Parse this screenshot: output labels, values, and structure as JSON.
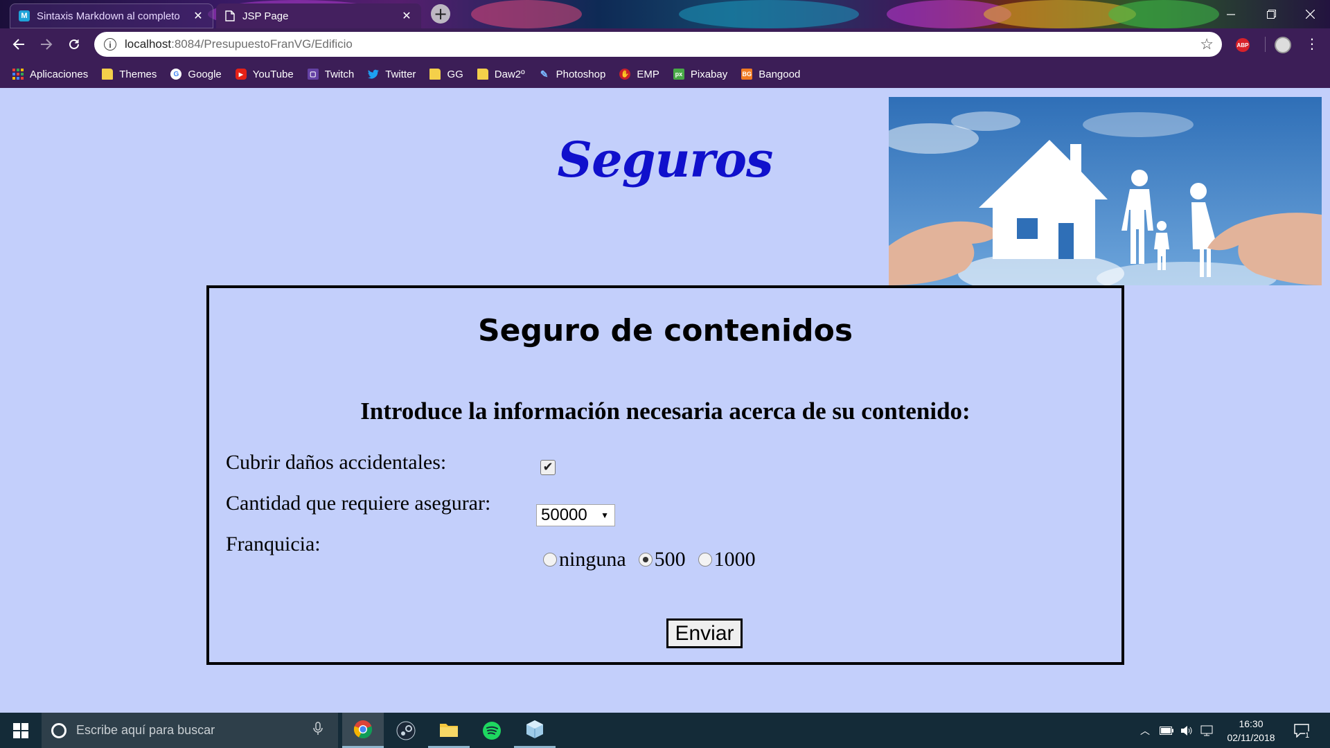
{
  "browser": {
    "tabs": [
      {
        "title": "Sintaxis Markdown al completo",
        "active": false,
        "favicon": "markdown-icon"
      },
      {
        "title": "JSP Page",
        "active": true,
        "favicon": "page-icon"
      }
    ],
    "url_host": "localhost",
    "url_path": ":8084/PresupuestoFranVG/Edificio",
    "extension_badge": "ABP",
    "bookmarks": [
      {
        "label": "Aplicaciones",
        "icon": "apps-grid-icon"
      },
      {
        "label": "Themes",
        "icon": "folder-icon"
      },
      {
        "label": "Google",
        "icon": "google-icon"
      },
      {
        "label": "YouTube",
        "icon": "youtube-icon"
      },
      {
        "label": "Twitch",
        "icon": "twitch-icon"
      },
      {
        "label": "Twitter",
        "icon": "twitter-icon"
      },
      {
        "label": "GG",
        "icon": "folder-icon"
      },
      {
        "label": "Daw2º",
        "icon": "folder-icon"
      },
      {
        "label": "Photoshop",
        "icon": "feather-icon"
      },
      {
        "label": "EMP",
        "icon": "emp-icon"
      },
      {
        "label": "Pixabay",
        "icon": "pixabay-icon"
      },
      {
        "label": "Bangood",
        "icon": "banggood-icon"
      }
    ]
  },
  "page": {
    "site_title": "Seguros",
    "hero_image": "house-family-hands-image",
    "form": {
      "heading": "Seguro de contenidos",
      "subheading": "Introduce la información necesaria acerca de su contenido:",
      "accidental_label": "Cubrir daños accidentales:",
      "accidental_checked": true,
      "amount_label": "Cantidad que requiere asegurar:",
      "amount_value": "50000",
      "franchise_label": "Franquicia:",
      "franchise_options": [
        "ninguna",
        "500",
        "1000"
      ],
      "franchise_selected": "500",
      "submit_label": "Enviar"
    }
  },
  "taskbar": {
    "search_placeholder": "Escribe aquí para buscar",
    "apps": [
      "chrome-icon",
      "steam-icon",
      "file-explorer-icon",
      "spotify-icon",
      "virtual-box-icon"
    ],
    "time": "16:30",
    "date": "02/11/2018",
    "notification_count": "1"
  },
  "colors": {
    "page_background": "#c3cffb",
    "site_title": "#1010cc",
    "browser_chrome": "#3c1e57",
    "taskbar": "#142b38"
  }
}
